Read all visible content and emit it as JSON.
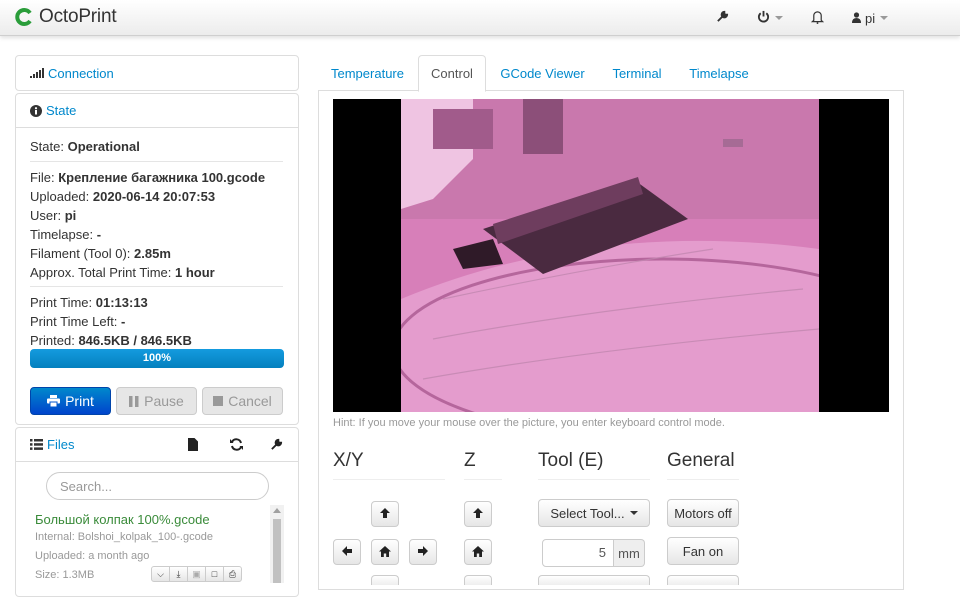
{
  "app": {
    "brand": "OctoPrint",
    "user": "pi"
  },
  "nav": {
    "icons": [
      "wrench-icon",
      "power-icon",
      "bell-icon",
      "user-icon"
    ]
  },
  "sidebar": {
    "connection": {
      "title": "Connection"
    },
    "state": {
      "title": "State",
      "state_label": "State:",
      "state_value": "Operational",
      "file_label": "File:",
      "file_value": "Крепление багажника 100.gcode",
      "uploaded_label": "Uploaded:",
      "uploaded_value": "2020-06-14 20:07:53",
      "user_label": "User:",
      "user_value": "pi",
      "timelapse_label": "Timelapse:",
      "timelapse_value": "-",
      "filament_label": "Filament (Tool 0):",
      "filament_value": "2.85m",
      "approx_label": "Approx. Total Print Time:",
      "approx_value": "1 hour",
      "print_time_label": "Print Time:",
      "print_time_value": "01:13:13",
      "time_left_label": "Print Time Left:",
      "time_left_value": "-",
      "printed_label": "Printed:",
      "printed_value": "846.5KB / 846.5KB",
      "progress_text": "100%",
      "progress_fraction": 1.0,
      "buttons": {
        "print": "Print",
        "pause": "Pause",
        "cancel": "Cancel"
      }
    },
    "files": {
      "title": "Files",
      "search_placeholder": "Search...",
      "items": [
        {
          "name": "Большой колпак 100%.gcode",
          "internal": "Internal: Bolshoi_kolpak_100-.gcode",
          "uploaded": "Uploaded: a month ago",
          "size": "Size: 1.3MB"
        }
      ]
    }
  },
  "tabs": [
    {
      "label": "Temperature",
      "active": false
    },
    {
      "label": "Control",
      "active": true
    },
    {
      "label": "GCode Viewer",
      "active": false
    },
    {
      "label": "Terminal",
      "active": false
    },
    {
      "label": "Timelapse",
      "active": false
    }
  ],
  "control": {
    "hint": "Hint: If you move your mouse over the picture, you enter keyboard control mode.",
    "headings": {
      "xy": "X/Y",
      "z": "Z",
      "tool": "Tool (E)",
      "general": "General"
    },
    "select_tool": "Select Tool...",
    "extrude_amount": "5",
    "extrude_unit": "mm",
    "motors_off": "Motors off",
    "fan_on": "Fan on"
  },
  "colors": {
    "link": "#0088cc",
    "primary": "#0044cc",
    "progress": "#149bdf",
    "file_green": "#3a8b3a",
    "webcam_tint": "#e488c8"
  }
}
